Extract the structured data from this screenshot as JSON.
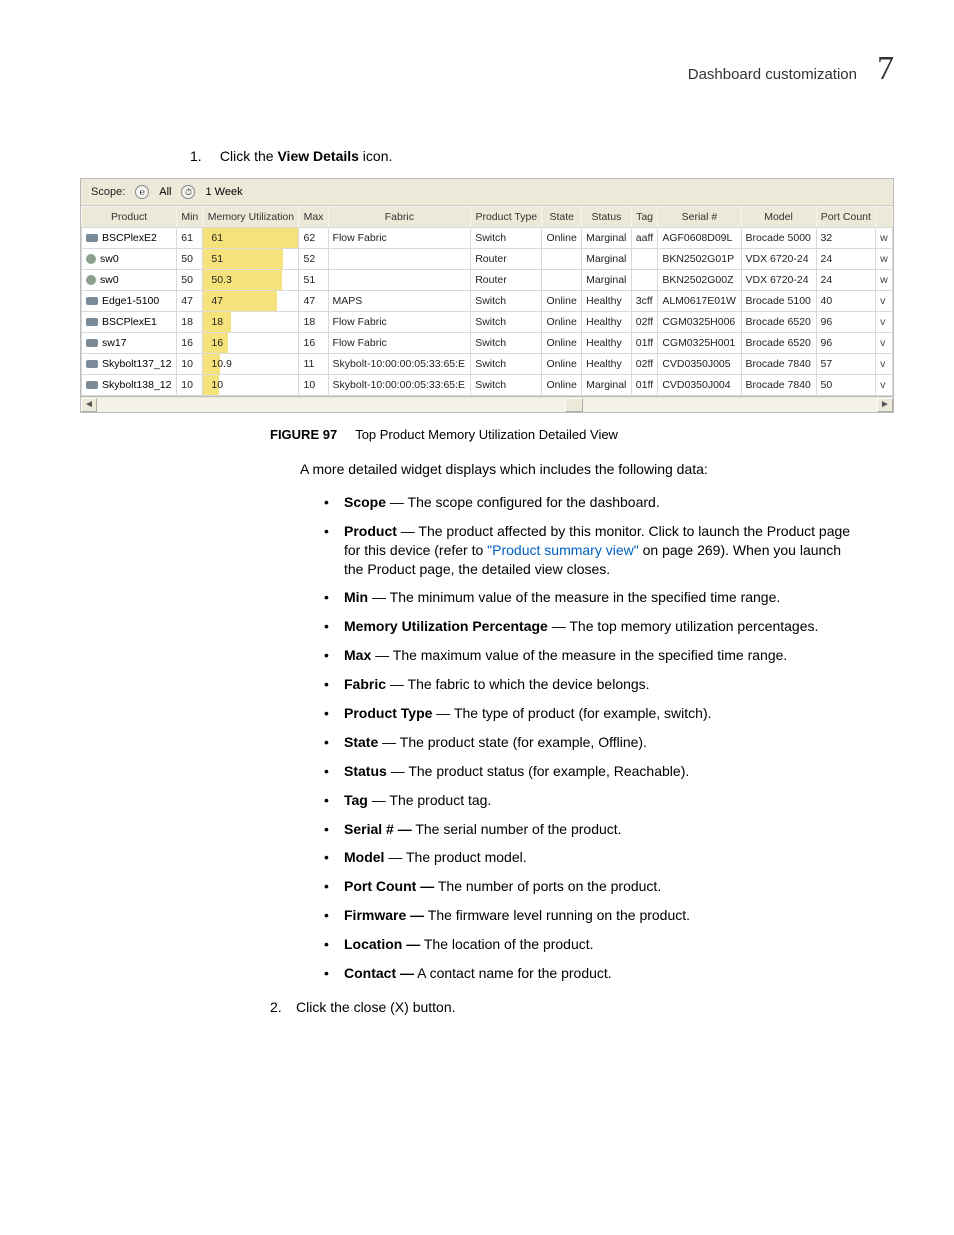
{
  "header": {
    "title": "Dashboard customization",
    "chapter": "7"
  },
  "step1": {
    "num": "1.",
    "pre": "Click the ",
    "bold": "View Details",
    "post": " icon."
  },
  "scope": {
    "label": "Scope:",
    "network_icon_txt": "℮",
    "network_value": "All",
    "time_icon_txt": "⏱",
    "time_value": "1 Week"
  },
  "columns": [
    "Product",
    "Min",
    "Memory Utilization",
    "Max",
    "Fabric",
    "Product Type",
    "State",
    "Status",
    "Tag",
    "Serial #",
    "Model",
    "Port Count",
    ""
  ],
  "rows": [
    {
      "icon": "switch",
      "product": "BSCPlexE2",
      "min": "61",
      "mem": "61",
      "memPct": 98,
      "max": "62",
      "fabric": "Flow Fabric",
      "ptype": "Switch",
      "state": "Online",
      "status": "Marginal",
      "tag": "aaff",
      "serial": "AGF0608D09L",
      "model": "Brocade 5000",
      "port": "32",
      "cut": "w"
    },
    {
      "icon": "router",
      "product": "sw0",
      "min": "50",
      "mem": "51",
      "memPct": 98,
      "max": "52",
      "fabric": "",
      "ptype": "Router",
      "state": "",
      "status": "Marginal",
      "tag": "",
      "serial": "BKN2502G01P",
      "model": "VDX 6720-24",
      "port": "24",
      "cut": "w"
    },
    {
      "icon": "router",
      "product": "sw0",
      "min": "50",
      "mem": "50.3",
      "memPct": 99,
      "max": "51",
      "fabric": "",
      "ptype": "Router",
      "state": "",
      "status": "Marginal",
      "tag": "",
      "serial": "BKN2502G00Z",
      "model": "VDX 6720-24",
      "port": "24",
      "cut": "w"
    },
    {
      "icon": "switch",
      "product": "Edge1-5100",
      "min": "47",
      "mem": "47",
      "memPct": 100,
      "max": "47",
      "fabric": "MAPS",
      "ptype": "Switch",
      "state": "Online",
      "status": "Healthy",
      "tag": "3cff",
      "serial": "ALM0617E01W",
      "model": "Brocade 5100",
      "port": "40",
      "cut": "v"
    },
    {
      "icon": "switch",
      "product": "BSCPlexE1",
      "min": "18",
      "mem": "18",
      "memPct": 100,
      "max": "18",
      "fabric": "Flow Fabric",
      "ptype": "Switch",
      "state": "Online",
      "status": "Healthy",
      "tag": "02ff",
      "serial": "CGM0325H006",
      "model": "Brocade 6520",
      "port": "96",
      "cut": "v"
    },
    {
      "icon": "switch",
      "product": "sw17",
      "min": "16",
      "mem": "16",
      "memPct": 100,
      "max": "16",
      "fabric": "Flow Fabric",
      "ptype": "Switch",
      "state": "Online",
      "status": "Healthy",
      "tag": "01ff",
      "serial": "CGM0325H001",
      "model": "Brocade 6520",
      "port": "96",
      "cut": "v"
    },
    {
      "icon": "switch",
      "product": "Skybolt137_12",
      "min": "10",
      "mem": "10.9",
      "memPct": 99,
      "max": "11",
      "fabric": "Skybolt-10:00:00:05:33:65:E",
      "ptype": "Switch",
      "state": "Online",
      "status": "Healthy",
      "tag": "02ff",
      "serial": "CVD0350J005",
      "model": "Brocade 7840",
      "port": "57",
      "cut": "v"
    },
    {
      "icon": "switch",
      "product": "Skybolt138_12",
      "min": "10",
      "mem": "10",
      "memPct": 100,
      "max": "10",
      "fabric": "Skybolt-10:00:00:05:33:65:E",
      "ptype": "Switch",
      "state": "Online",
      "status": "Marginal",
      "tag": "01ff",
      "serial": "CVD0350J004",
      "model": "Brocade 7840",
      "port": "50",
      "cut": "v"
    }
  ],
  "figcap": {
    "label": "FIGURE 97",
    "text": "Top Product Memory Utilization Detailed View"
  },
  "intro": "A more detailed widget displays which includes the following data:",
  "defs": [
    {
      "term": "Scope",
      "desc": " — The scope configured for the dashboard."
    },
    {
      "term": "Product",
      "desc": " — The product affected by this monitor. Click to launch the Product page for this device (refer to ",
      "link": "\"Product summary view\"",
      "desc2": " on page 269). When you launch the Product page, the detailed view closes."
    },
    {
      "term": "Min",
      "desc": " — The minimum value of the measure in the specified time range."
    },
    {
      "term": "Memory Utilization Percentage",
      "desc": " — The top memory utilization percentages."
    },
    {
      "term": "Max",
      "desc": " — The maximum value of the measure in the specified time range."
    },
    {
      "term": "Fabric",
      "desc": " — The fabric to which the device belongs."
    },
    {
      "term": "Product Type",
      "desc": " — The type of product (for example, switch)."
    },
    {
      "term": "State",
      "desc": " — The product state (for example, Offline)."
    },
    {
      "term": "Status",
      "desc": " — The product status (for example, Reachable)."
    },
    {
      "term": "Tag",
      "desc": " — The product tag."
    },
    {
      "term": "Serial # —",
      "desc": " The serial number of the product."
    },
    {
      "term": "Model",
      "desc": " — The product model."
    },
    {
      "term": "Port Count —",
      "desc": " The number of ports on the product."
    },
    {
      "term": "Firmware —",
      "desc": " The firmware level running on the product."
    },
    {
      "term": "Location —",
      "desc": " The location of the product."
    },
    {
      "term": "Contact —",
      "desc": " A contact name for the product."
    }
  ],
  "step2": {
    "num": "2.",
    "text": "Click the close (X) button."
  },
  "chart_data": {
    "type": "table",
    "title": "Top Product Memory Utilization Detailed View",
    "columns": [
      "Product",
      "Min",
      "Memory Utilization",
      "Max",
      "Fabric",
      "Product Type",
      "State",
      "Status",
      "Tag",
      "Serial #",
      "Model",
      "Port Count"
    ],
    "rows": [
      [
        "BSCPlexE2",
        61,
        61,
        62,
        "Flow Fabric",
        "Switch",
        "Online",
        "Marginal",
        "aaff",
        "AGF0608D09L",
        "Brocade 5000",
        32
      ],
      [
        "sw0",
        50,
        51,
        52,
        "",
        "Router",
        "",
        "Marginal",
        "",
        "BKN2502G01P",
        "VDX 6720-24",
        24
      ],
      [
        "sw0",
        50,
        50.3,
        51,
        "",
        "Router",
        "",
        "Marginal",
        "",
        "BKN2502G00Z",
        "VDX 6720-24",
        24
      ],
      [
        "Edge1-5100",
        47,
        47,
        47,
        "MAPS",
        "Switch",
        "Online",
        "Healthy",
        "3cff",
        "ALM0617E01W",
        "Brocade 5100",
        40
      ],
      [
        "BSCPlexE1",
        18,
        18,
        18,
        "Flow Fabric",
        "Switch",
        "Online",
        "Healthy",
        "02ff",
        "CGM0325H006",
        "Brocade 6520",
        96
      ],
      [
        "sw17",
        16,
        16,
        16,
        "Flow Fabric",
        "Switch",
        "Online",
        "Healthy",
        "01ff",
        "CGM0325H001",
        "Brocade 6520",
        96
      ],
      [
        "Skybolt137_12",
        10,
        10.9,
        11,
        "Skybolt-10:00:00:05:33:65:E",
        "Switch",
        "Online",
        "Healthy",
        "02ff",
        "CVD0350J005",
        "Brocade 7840",
        57
      ],
      [
        "Skybolt138_12",
        10,
        10,
        10,
        "Skybolt-10:00:00:05:33:65:E",
        "Switch",
        "Online",
        "Marginal",
        "01ff",
        "CVD0350J004",
        "Brocade 7840",
        50
      ]
    ]
  }
}
